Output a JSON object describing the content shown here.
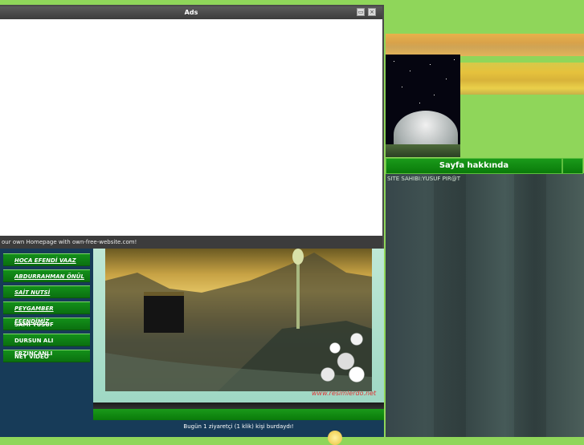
{
  "popup": {
    "title": "Ads",
    "footer": "our own Homepage with own-free-website.com!"
  },
  "sidebar_right": {
    "heading": "Sayfa hakkında",
    "owner": "SITE SAHIBI:YUSUF PIR@T"
  },
  "menu": {
    "items": [
      {
        "label": "HOCA EFENDİ VAAZ",
        "underline": true
      },
      {
        "label": "ABDURRAHMAN ÖNÜL",
        "underline": true
      },
      {
        "label": "SAİT NUTSİ",
        "underline": true
      },
      {
        "label": "PEYGAMBER EFENDİMİZ",
        "underline": true
      },
      {
        "label": "SAMI YUSUF",
        "underline": false
      },
      {
        "label": "DURSUN ALI ERZINCANLI",
        "underline": false
      },
      {
        "label": "NEY VIDEO",
        "underline": false
      }
    ]
  },
  "main": {
    "watermark": "www.resimlerdo.net",
    "counter": "Bugün 1 ziyaretçi (1 klik) kişi burdaydı!"
  },
  "colors": {
    "background": "#8fd65a",
    "menu_green": "#13901a",
    "navy": "#173b58"
  }
}
